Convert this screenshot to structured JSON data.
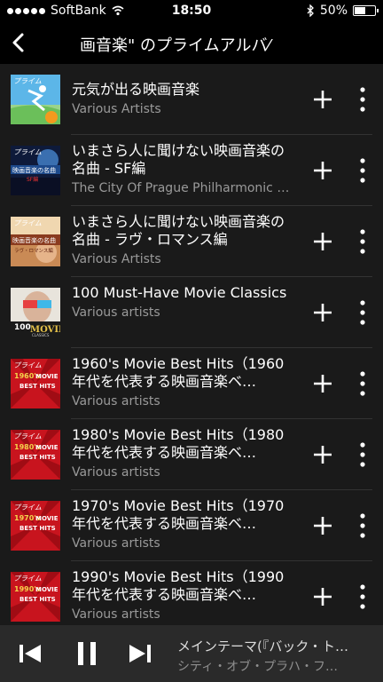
{
  "status": {
    "carrier": "SoftBank",
    "time": "18:50",
    "battery": "50%",
    "battery_level": 0.5,
    "icons": [
      "signal-dots-icon",
      "wifi-icon",
      "bluetooth-icon",
      "battery-icon"
    ]
  },
  "header": {
    "title": "画音楽\" のプライムアルバ⁄",
    "back_icon": "chevron-left-icon"
  },
  "albums": [
    {
      "title": "元気が出る映画音楽",
      "artist": "Various Artists"
    },
    {
      "title": "いまさら人に聞けない映画音楽の名曲 - SF編",
      "artist": "The City Of Prague Philharmonic O…"
    },
    {
      "title": "いまさら人に聞けない映画音楽の名曲 - ラヴ・ロマンス編",
      "artist": "Various Artists"
    },
    {
      "title": "100 Must-Have Movie Classics",
      "artist": "Various artists"
    },
    {
      "title": "1960's Movie Best Hits（1960年代を代表する映画音楽ベ…",
      "artist": "Various artists"
    },
    {
      "title": "1980's Movie Best Hits（1980年代を代表する映画音楽ベ…",
      "artist": "Various artists"
    },
    {
      "title": "1970's Movie Best Hits（1970年代を代表する映画音楽ベ…",
      "artist": "Various artists"
    },
    {
      "title": "1990's Movie Best Hits（1990年代を代表する映画音楽ベ…",
      "artist": "Various artists"
    }
  ],
  "cover_text": {
    "prime": "プライム",
    "sf_line1": "映画音楽の名曲",
    "sf_line2": "SF編",
    "love_line1": "映画音楽の名曲",
    "love_line2": "ラヴ・ロマンス編",
    "classics_line1": "100",
    "classics_line2": "MOVIE",
    "classics_line3": "CLASSICS",
    "best_line1": "MOVIE",
    "best_line2": "BEST HITS",
    "decade_1960": "1960's",
    "decade_1980": "1980's",
    "decade_1970": "1970's",
    "decade_1990": "1990's"
  },
  "row_icons": {
    "add": "plus-icon",
    "more": "more-vertical-icon"
  },
  "player": {
    "now_playing_title": "メインテーマ(『バック・ト…",
    "now_playing_artist": "シティ・オブ・プラハ・フ…",
    "prev_icon": "skip-previous-icon",
    "pause_icon": "pause-icon",
    "next_icon": "skip-next-icon"
  },
  "colors": {
    "background": "#000000",
    "list_background": "#1a1a1a",
    "secondary_text": "#9a9a9a",
    "player_background": "#2a2a2a"
  }
}
